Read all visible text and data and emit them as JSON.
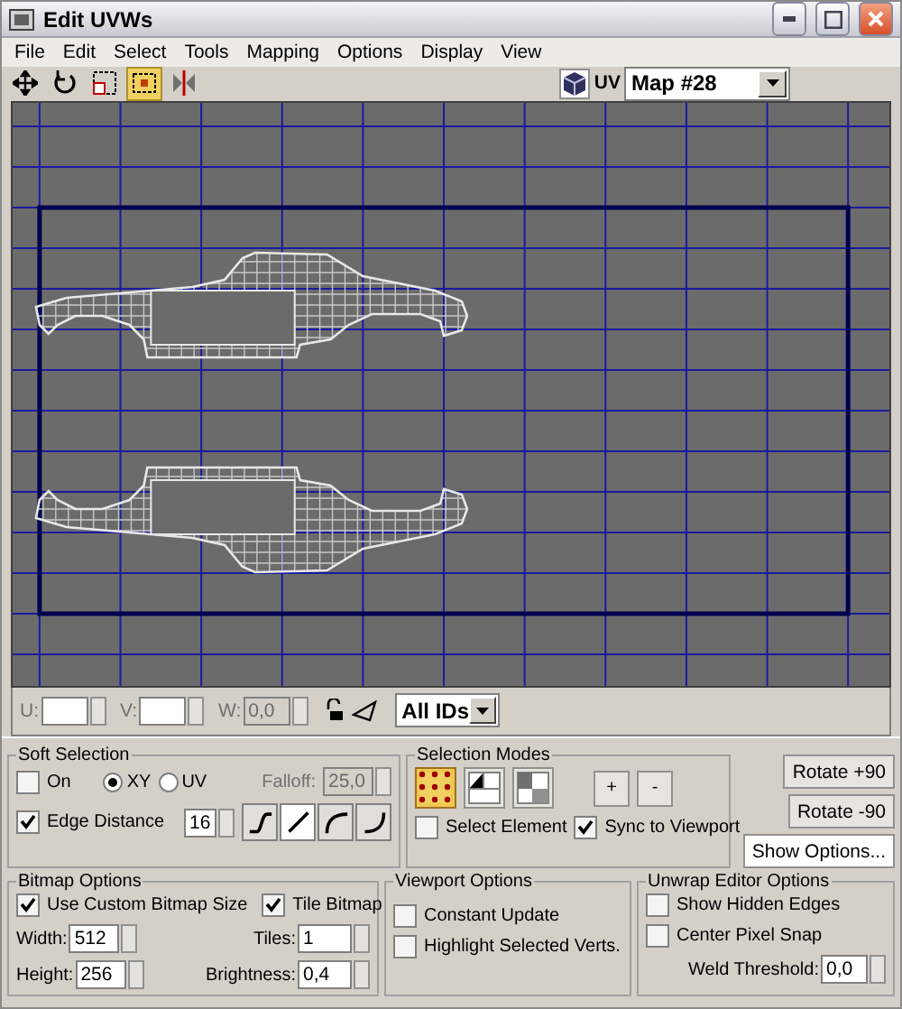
{
  "window": {
    "title": "Edit UVWs"
  },
  "menu": [
    "File",
    "Edit",
    "Select",
    "Tools",
    "Mapping",
    "Options",
    "Display",
    "View"
  ],
  "tools": [
    {
      "kind": "move",
      "selected": false
    },
    {
      "kind": "rotate",
      "selected": false
    },
    {
      "kind": "scale",
      "selected": false
    },
    {
      "kind": "freeform",
      "selected": true
    },
    {
      "kind": "mirror",
      "selected": false
    }
  ],
  "uv_label": "UV",
  "map_dropdown": "Map #28",
  "coords": [
    {
      "label": "U:",
      "disabled": false
    },
    {
      "label": "V:",
      "disabled": false
    },
    {
      "label": "W:",
      "value": "0,0",
      "disabled": true
    }
  ],
  "ids_dropdown": "All IDs",
  "soft_selection": {
    "title": "Soft Selection",
    "on": {
      "label": "On",
      "checked": false
    },
    "modes": [
      {
        "label": "XY",
        "selected": true
      },
      {
        "label": "UV",
        "selected": false
      }
    ],
    "falloff": {
      "label": "Falloff:",
      "value": "25,0",
      "disabled": true
    },
    "edge_distance": {
      "label": "Edge Distance",
      "checked": true,
      "value": "16"
    },
    "curves": [
      {
        "kind": "s",
        "selected": false
      },
      {
        "kind": "linear",
        "selected": true
      },
      {
        "kind": "in",
        "selected": false
      },
      {
        "kind": "out",
        "selected": false
      }
    ]
  },
  "selection_modes": {
    "title": "Selection Modes",
    "modes": [
      {
        "kind": "vertex",
        "selected": true
      },
      {
        "kind": "edge",
        "selected": false
      },
      {
        "kind": "face",
        "selected": false
      }
    ],
    "grow": "+",
    "shrink": "-",
    "select_element": {
      "label": "Select Element",
      "checked": false
    },
    "sync": {
      "label": "Sync to Viewport",
      "checked": true
    }
  },
  "buttons": [
    "Rotate +90",
    "Rotate -90",
    "Show Options..."
  ],
  "bitmap_options": {
    "title": "Bitmap Options",
    "custom_size": {
      "label": "Use Custom Bitmap Size",
      "checked": true
    },
    "tile": {
      "label": "Tile Bitmap",
      "checked": true
    },
    "width": {
      "label": "Width:",
      "value": "512"
    },
    "height": {
      "label": "Height:",
      "value": "256"
    },
    "tiles": {
      "label": "Tiles:",
      "value": "1"
    },
    "brightness": {
      "label": "Brightness:",
      "value": "0,4"
    }
  },
  "viewport_options": {
    "title": "Viewport Options",
    "items": [
      {
        "label": "Constant Update",
        "checked": false
      },
      {
        "label": "Highlight Selected Verts.",
        "checked": false
      }
    ]
  },
  "editor_options": {
    "title": "Unwrap Editor Options",
    "items": [
      {
        "label": "Show Hidden Edges",
        "checked": false
      },
      {
        "label": "Center Pixel Snap",
        "checked": false
      }
    ],
    "weld": {
      "label": "Weld Threshold:",
      "value": "0,0"
    }
  }
}
